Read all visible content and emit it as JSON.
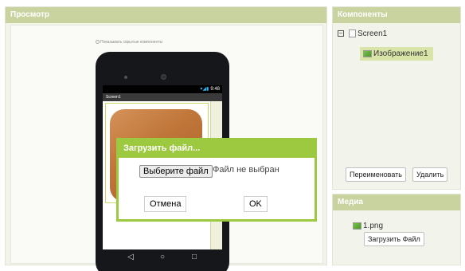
{
  "viewer": {
    "title": "Просмотр",
    "hidden_toggle_label": "Показывать скрытые компоненты",
    "phone": {
      "status_time": "9:48",
      "screen_title": "Screen1"
    }
  },
  "dialog": {
    "title": "Загрузить файл...",
    "choose_file_label": "Выберите файл",
    "file_status": "Файл не выбран",
    "cancel_label": "Отмена",
    "ok_label": "OK"
  },
  "components": {
    "title": "Компоненты",
    "tree": [
      {
        "label": "Screen1"
      },
      {
        "label": "Изображение1"
      }
    ],
    "rename_label": "Переименовать",
    "delete_label": "Удалить"
  },
  "media": {
    "title": "Медиа",
    "files": [
      {
        "name": "1.png"
      }
    ],
    "upload_label": "Загрузить Файл"
  },
  "colors": {
    "header": "#c8d3a0",
    "dialog_accent": "#9cc93f",
    "selection": "#d9e4a8"
  }
}
